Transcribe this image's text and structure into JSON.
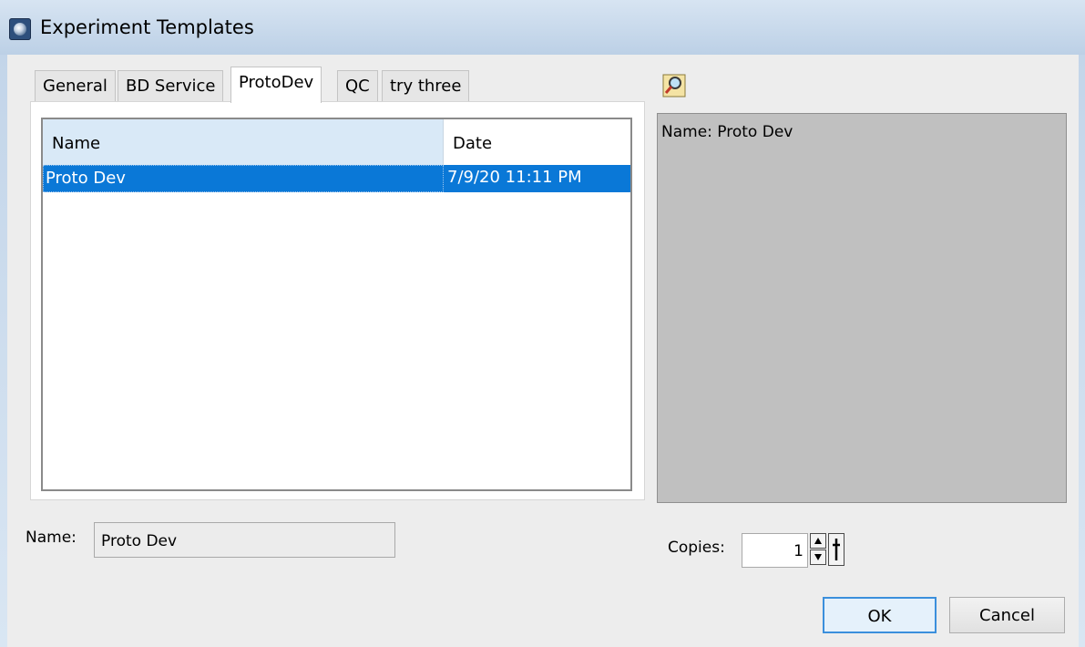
{
  "window": {
    "title": "Experiment Templates"
  },
  "tabs": [
    {
      "label": "General"
    },
    {
      "label": "BD Service"
    },
    {
      "label": "ProtoDev",
      "active": true
    },
    {
      "label": "QC"
    },
    {
      "label": "try three"
    }
  ],
  "table": {
    "columns": [
      "Name",
      "Date"
    ],
    "rows": [
      {
        "name": "Proto Dev",
        "date": "7/9/20 11:11 PM",
        "selected": true
      }
    ]
  },
  "preview": {
    "text": "Name: Proto Dev",
    "zoom_icon": "zoom-icon"
  },
  "name_field": {
    "label": "Name:",
    "value": "Proto Dev"
  },
  "copies": {
    "label": "Copies:",
    "value": "1"
  },
  "buttons": {
    "ok": "OK",
    "cancel": "Cancel"
  },
  "colors": {
    "selection": "#0a78d7",
    "header": "#d9e9f7",
    "preview_bg": "#c0c0c0",
    "default_button_border": "#3b8fdc"
  }
}
